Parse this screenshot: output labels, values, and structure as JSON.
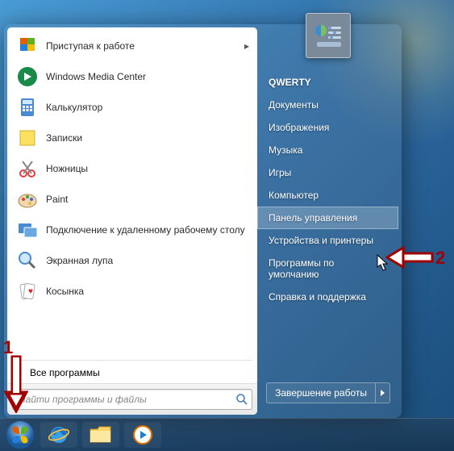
{
  "user_name": "QWERTY",
  "left_programs": [
    {
      "key": "getting-started",
      "label": "Приступая к работе",
      "icon": "flag",
      "has_sub": true
    },
    {
      "key": "wmc",
      "label": "Windows Media Center",
      "icon": "wmc",
      "has_sub": false
    },
    {
      "key": "calc",
      "label": "Калькулятор",
      "icon": "calc",
      "has_sub": false
    },
    {
      "key": "notes",
      "label": "Записки",
      "icon": "notes",
      "has_sub": false
    },
    {
      "key": "snip",
      "label": "Ножницы",
      "icon": "snip",
      "has_sub": false
    },
    {
      "key": "paint",
      "label": "Paint",
      "icon": "paint",
      "has_sub": false
    },
    {
      "key": "rdp",
      "label": "Подключение к удаленному рабочему столу",
      "icon": "rdp",
      "has_sub": false
    },
    {
      "key": "magnifier",
      "label": "Экранная лупа",
      "icon": "mag",
      "has_sub": false
    },
    {
      "key": "solitaire",
      "label": "Косынка",
      "icon": "cards",
      "has_sub": false
    }
  ],
  "all_programs_label": "Все программы",
  "search_placeholder": "Найти программы и файлы",
  "right_items": [
    {
      "key": "documents",
      "label": "Документы"
    },
    {
      "key": "pictures",
      "label": "Изображения"
    },
    {
      "key": "music",
      "label": "Музыка"
    },
    {
      "key": "games",
      "label": "Игры"
    },
    {
      "key": "computer",
      "label": "Компьютер"
    },
    {
      "key": "control-panel",
      "label": "Панель управления",
      "highlighted": true
    },
    {
      "key": "devices",
      "label": "Устройства и принтеры"
    },
    {
      "key": "defaults",
      "label": "Программы по умолчанию"
    },
    {
      "key": "help",
      "label": "Справка и поддержка"
    }
  ],
  "shutdown_label": "Завершение работы",
  "annotations": {
    "label1": "1",
    "label2": "2"
  }
}
